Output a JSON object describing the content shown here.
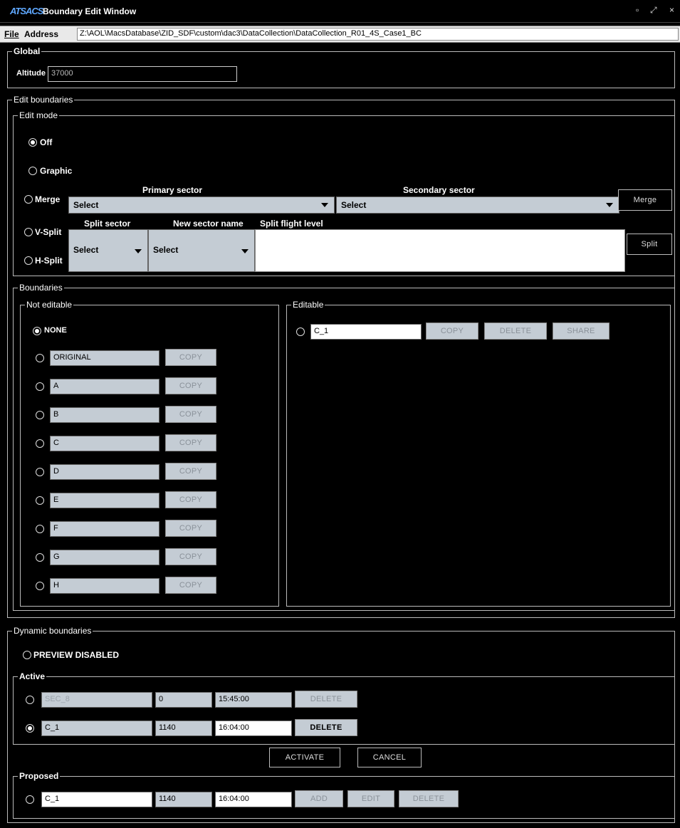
{
  "window": {
    "logo": "ATSACS",
    "title": "Boundary Edit Window",
    "controls": [
      "▫",
      "⤢",
      "×"
    ]
  },
  "menu": {
    "file": "File",
    "address_label": "Address",
    "address_value": "Z:\\AOL\\MacsDatabase\\ZID_SDF\\custom\\dac3\\DataCollection\\DataCollection_R01_4S_Case1_BC"
  },
  "global": {
    "legend": "Global",
    "altitude_label": "Altitude",
    "altitude_value": "37000"
  },
  "edit_boundaries": {
    "legend": "Edit boundaries",
    "edit_mode": {
      "legend": "Edit mode",
      "off": "Off",
      "graphic": "Graphic",
      "merge": "Merge",
      "vsplit": "V-Split",
      "hsplit": "H-Split",
      "primary_sector_header": "Primary sector",
      "secondary_sector_header": "Secondary sector",
      "primary_select": "Select",
      "secondary_select": "Select",
      "merge_button": "Merge",
      "split_sector_header": "Split sector",
      "new_sector_name_header": "New sector name",
      "split_flight_level_header": "Split flight level",
      "split_sector_select": "Select",
      "new_sector_name_select": "Select",
      "split_button": "Split"
    },
    "boundaries": {
      "legend": "Boundaries",
      "not_editable": {
        "legend": "Not editable",
        "none_label": "NONE",
        "copy_label": "COPY",
        "items": [
          "ORIGINAL",
          "A",
          "B",
          "C",
          "D",
          "E",
          "F",
          "G",
          "H"
        ]
      },
      "editable": {
        "legend": "Editable",
        "name": "C_1",
        "copy": "COPY",
        "delete": "DELETE",
        "share": "SHARE"
      }
    }
  },
  "dynamic": {
    "legend": "Dynamic boundaries",
    "preview": "PREVIEW DISABLED",
    "active": {
      "legend": "Active",
      "rows": [
        {
          "name": "SEC_8",
          "value": "0",
          "time": "15:45:00",
          "delete": "DELETE"
        },
        {
          "name": "C_1",
          "value": "1140",
          "time": "16:04:00",
          "delete": "DELETE"
        }
      ]
    },
    "activate": "ACTIVATE",
    "cancel": "CANCEL",
    "proposed": {
      "legend": "Proposed",
      "name": "C_1",
      "value": "1140",
      "time": "16:04:00",
      "add": "ADD",
      "edit": "EDIT",
      "delete": "DELETE"
    }
  }
}
